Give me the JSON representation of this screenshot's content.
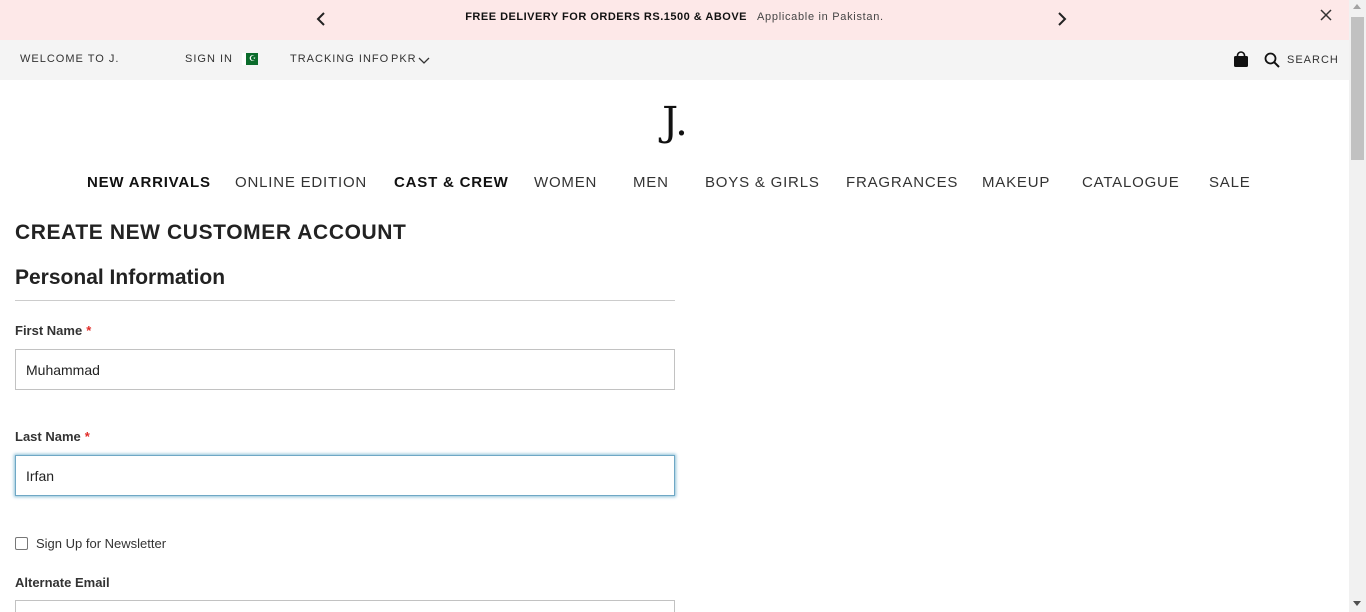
{
  "promo": {
    "headline": "FREE DELIVERY FOR ORDERS RS.1500 & ABOVE",
    "subtext": "Applicable in Pakistan."
  },
  "topbar": {
    "welcome": "WELCOME TO J.",
    "sign_in": "SIGN IN",
    "flag": "☪",
    "tracking": "TRACKING INFO",
    "currency": "PKR",
    "search": "SEARCH"
  },
  "logo": {
    "text": "J."
  },
  "nav": {
    "new_arrivals": "NEW ARRIVALS",
    "online_edition": "ONLINE EDITION",
    "cast_crew": "CAST & CREW",
    "women": "WOMEN",
    "men": "MEN",
    "boys_girls": "BOYS & GIRLS",
    "fragrances": "FRAGRANCES",
    "makeup": "MAKEUP",
    "catalogue": "CATALOGUE",
    "sale": "SALE"
  },
  "form": {
    "page_title": "CREATE NEW CUSTOMER ACCOUNT",
    "section_title": "Personal Information",
    "required_mark": "*",
    "first_name_label": "First Name",
    "first_name_value": "Muhammad",
    "last_name_label": "Last Name",
    "last_name_value": "Irfan",
    "newsletter_label": "Sign Up for Newsletter",
    "alternate_email_label": "Alternate Email"
  },
  "icons": {
    "prev": "chevron-left-icon",
    "next": "chevron-right-icon",
    "close": "close-icon",
    "currency_dropdown": "chevron-down-icon",
    "cart": "shopping-bag-icon",
    "search": "search-icon"
  },
  "colors": {
    "promo_bg": "#fde8e8",
    "topbar_bg": "#f4f4f4",
    "required": "#e02b27",
    "focus_border": "#6fa8c5",
    "flag_green": "#0b6b2b"
  }
}
